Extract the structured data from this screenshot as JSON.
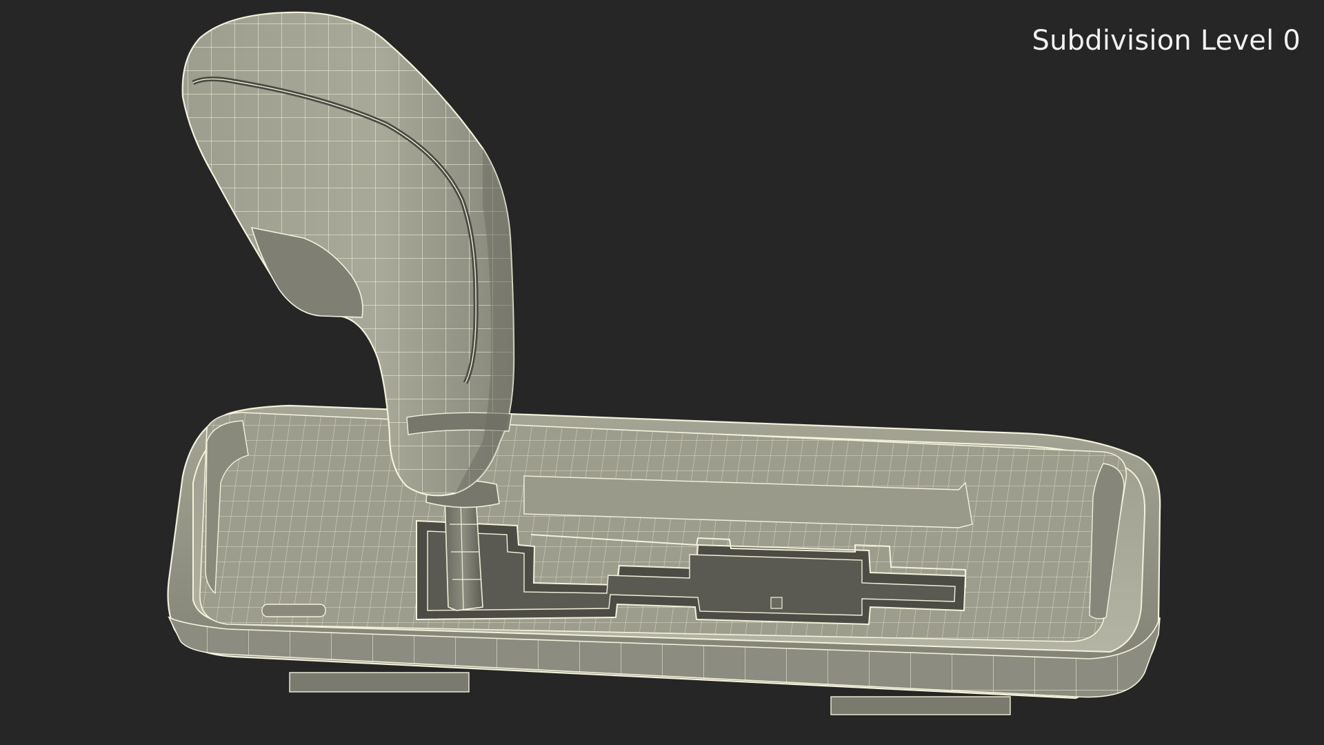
{
  "viewport": {
    "overlay_label": "Subdivision Level 0"
  },
  "colors": {
    "background": "#262626",
    "surface_light": "#a8a898",
    "surface_mid": "#8e8e80",
    "surface_dark": "#5e5e54",
    "cavity": "#4a4a43",
    "wire": "#f4f2dc"
  }
}
